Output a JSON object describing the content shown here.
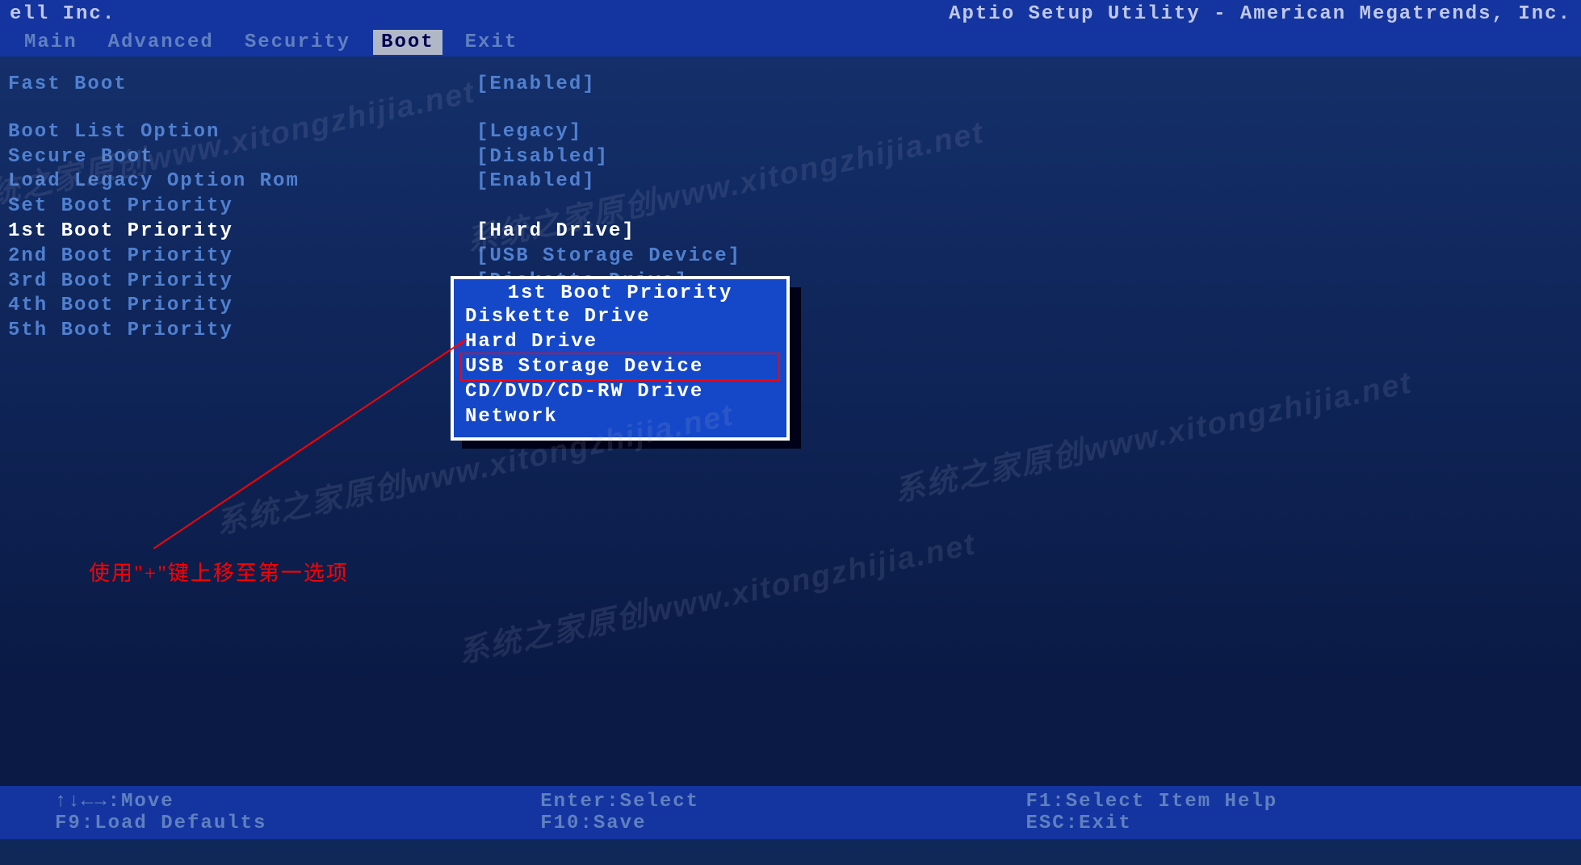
{
  "vendor": "ell Inc.",
  "utility_title": "Aptio Setup Utility - American Megatrends, Inc.",
  "tabs": [
    "Main",
    "Advanced",
    "Security",
    "Boot",
    "Exit"
  ],
  "active_tab_index": 3,
  "settings": [
    {
      "label": "Fast Boot",
      "value": "[Enabled]",
      "selected": false,
      "spacer_after": true
    },
    {
      "label": "Boot List Option",
      "value": "[Legacy]",
      "selected": false
    },
    {
      "label": "Secure Boot",
      "value": "[Disabled]",
      "selected": false
    },
    {
      "label": "Load Legacy Option Rom",
      "value": "[Enabled]",
      "selected": false
    },
    {
      "label": "Set Boot Priority",
      "value": "",
      "selected": false
    },
    {
      "label": "1st Boot Priority",
      "value": "[Hard Drive]",
      "selected": true
    },
    {
      "label": "2nd Boot Priority",
      "value": "[USB Storage Device]",
      "selected": false
    },
    {
      "label": "3rd Boot Priority",
      "value": "[Diskette Drive]",
      "selected": false
    },
    {
      "label": "4th Boot Priority",
      "value": "",
      "selected": false
    },
    {
      "label": "5th Boot Priority",
      "value": "",
      "selected": false
    }
  ],
  "popup": {
    "title": "1st Boot Priority",
    "items": [
      "Diskette Drive",
      "Hard Drive",
      "USB Storage Device",
      "CD/DVD/CD-RW Drive",
      "Network"
    ],
    "highlighted_index": 2
  },
  "annotation": "使用\"+\"键上移至第一选项",
  "footer": {
    "row1": [
      "↑↓←→:Move",
      "Enter:Select",
      "F1:Select Item Help"
    ],
    "row2": [
      "F9:Load Defaults",
      "F10:Save",
      "ESC:Exit"
    ]
  },
  "watermarks": [
    "系统之家原创www.xitongzhijia.net",
    "系统之家原创www.xitongzhijia.net",
    "系统之家原创www.xitongzhijia.net",
    "系统之家原创www.xitongzhijia.net",
    "系统之家原创www.xitongzhijia.net"
  ]
}
